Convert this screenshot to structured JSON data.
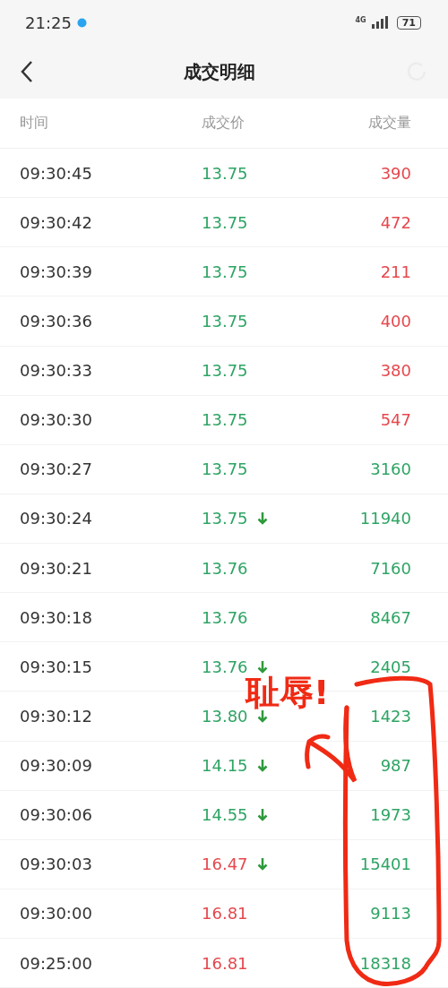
{
  "status_bar": {
    "time": "21:25",
    "network": "4G",
    "battery": "71"
  },
  "header": {
    "title": "成交明细"
  },
  "table": {
    "columns": [
      "时间",
      "成交价",
      "成交量"
    ],
    "rows": [
      {
        "time": "09:30:45",
        "price": "13.75",
        "price_rising": false,
        "arrow": false,
        "volume": "390",
        "volume_buy": true
      },
      {
        "time": "09:30:42",
        "price": "13.75",
        "price_rising": false,
        "arrow": false,
        "volume": "472",
        "volume_buy": true
      },
      {
        "time": "09:30:39",
        "price": "13.75",
        "price_rising": false,
        "arrow": false,
        "volume": "211",
        "volume_buy": true
      },
      {
        "time": "09:30:36",
        "price": "13.75",
        "price_rising": false,
        "arrow": false,
        "volume": "400",
        "volume_buy": true
      },
      {
        "time": "09:30:33",
        "price": "13.75",
        "price_rising": false,
        "arrow": false,
        "volume": "380",
        "volume_buy": true
      },
      {
        "time": "09:30:30",
        "price": "13.75",
        "price_rising": false,
        "arrow": false,
        "volume": "547",
        "volume_buy": true
      },
      {
        "time": "09:30:27",
        "price": "13.75",
        "price_rising": false,
        "arrow": false,
        "volume": "3160",
        "volume_buy": false
      },
      {
        "time": "09:30:24",
        "price": "13.75",
        "price_rising": false,
        "arrow": true,
        "volume": "11940",
        "volume_buy": false
      },
      {
        "time": "09:30:21",
        "price": "13.76",
        "price_rising": false,
        "arrow": false,
        "volume": "7160",
        "volume_buy": false
      },
      {
        "time": "09:30:18",
        "price": "13.76",
        "price_rising": false,
        "arrow": false,
        "volume": "8467",
        "volume_buy": false
      },
      {
        "time": "09:30:15",
        "price": "13.76",
        "price_rising": false,
        "arrow": true,
        "volume": "2405",
        "volume_buy": false
      },
      {
        "time": "09:30:12",
        "price": "13.80",
        "price_rising": false,
        "arrow": true,
        "volume": "1423",
        "volume_buy": false
      },
      {
        "time": "09:30:09",
        "price": "14.15",
        "price_rising": false,
        "arrow": true,
        "volume": "987",
        "volume_buy": false
      },
      {
        "time": "09:30:06",
        "price": "14.55",
        "price_rising": false,
        "arrow": true,
        "volume": "1973",
        "volume_buy": false
      },
      {
        "time": "09:30:03",
        "price": "16.47",
        "price_rising": true,
        "arrow": true,
        "volume": "15401",
        "volume_buy": false
      },
      {
        "time": "09:30:00",
        "price": "16.81",
        "price_rising": true,
        "arrow": false,
        "volume": "9113",
        "volume_buy": false
      },
      {
        "time": "09:25:00",
        "price": "16.81",
        "price_rising": true,
        "arrow": false,
        "volume": "18318",
        "volume_buy": false
      }
    ]
  },
  "annotation": {
    "text": "耻辱!"
  }
}
